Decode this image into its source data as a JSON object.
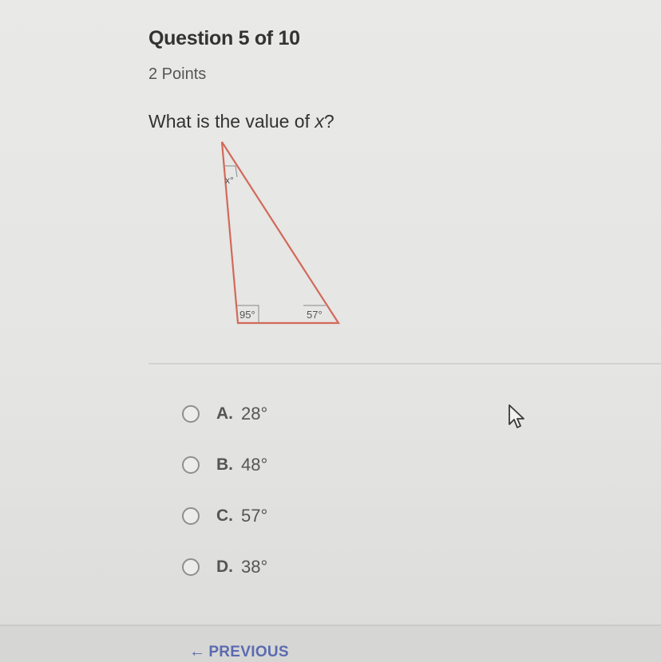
{
  "question": {
    "title": "Question 5 of 10",
    "points": "2 Points",
    "prompt_prefix": "What is the value of ",
    "prompt_var": "x",
    "prompt_suffix": "?"
  },
  "figure": {
    "label_top": "x°",
    "label_bottom_left": "95°",
    "label_bottom_right": "57°",
    "stroke_color": "#d2695a"
  },
  "options": [
    {
      "letter": "A.",
      "text": "28°"
    },
    {
      "letter": "B.",
      "text": "48°"
    },
    {
      "letter": "C.",
      "text": "57°"
    },
    {
      "letter": "D.",
      "text": "38°"
    }
  ],
  "nav": {
    "previous_label": "PREVIOUS",
    "previous_icon": "arrow-left-icon"
  },
  "colors": {
    "link": "#5b6bb0",
    "triangle": "#d2695a"
  }
}
